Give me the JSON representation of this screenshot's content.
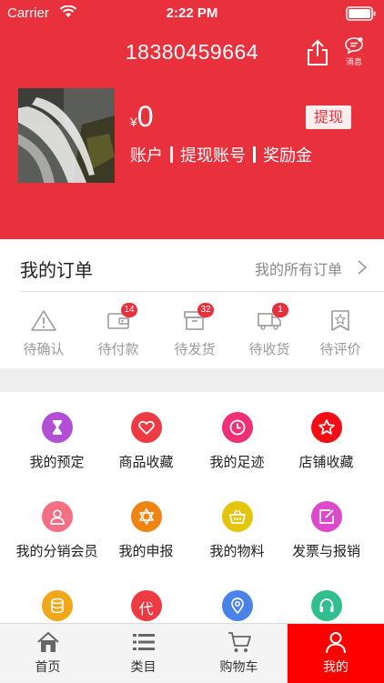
{
  "status_bar": {
    "carrier": "Carrier",
    "time": "2:22 PM"
  },
  "header": {
    "phone": "18380459664",
    "message_label": "消息",
    "currency": "¥",
    "balance": "0",
    "withdraw_label": "提现",
    "links": [
      "账户",
      "提现账号",
      "奖励金"
    ],
    "accent_color": "#e8313d"
  },
  "orders": {
    "title": "我的订单",
    "all_label": "我的所有订单",
    "statuses": [
      {
        "label": "待确认",
        "icon": "warning-icon",
        "badge": ""
      },
      {
        "label": "待付款",
        "icon": "wallet-icon",
        "badge": "14"
      },
      {
        "label": "待发货",
        "icon": "box-icon",
        "badge": "32"
      },
      {
        "label": "待收货",
        "icon": "truck-icon",
        "badge": "1"
      },
      {
        "label": "待评价",
        "icon": "review-icon",
        "badge": ""
      }
    ]
  },
  "features": [
    {
      "label": "我的预定",
      "icon": "hourglass-icon",
      "color": "#b24fd6"
    },
    {
      "label": "商品收藏",
      "icon": "heart-icon",
      "color": "#ee3b43"
    },
    {
      "label": "我的足迹",
      "icon": "clock-icon",
      "color": "#ef2f76"
    },
    {
      "label": "店铺收藏",
      "icon": "star-icon",
      "color": "#f40d15"
    },
    {
      "label": "我的分销会员",
      "icon": "user-icon",
      "color": "#f46e84"
    },
    {
      "label": "我的申报",
      "icon": "star-of-david-icon",
      "color": "#ef8413"
    },
    {
      "label": "我的物料",
      "icon": "basket-icon",
      "color": "#e5c50c"
    },
    {
      "label": "发票与报销",
      "icon": "edit-icon",
      "color": "#dc49c9"
    },
    {
      "label": "",
      "icon": "database-icon",
      "color": "#f2a619"
    },
    {
      "label": "",
      "icon": "agent-icon",
      "icon_text": "代",
      "color": "#ee3b43"
    },
    {
      "label": "",
      "icon": "location-icon",
      "color": "#4a83e8"
    },
    {
      "label": "",
      "icon": "headset-icon",
      "color": "#31bf8f"
    }
  ],
  "tabbar": {
    "tabs": [
      {
        "label": "首页",
        "icon": "home-icon"
      },
      {
        "label": "类目",
        "icon": "list-icon"
      },
      {
        "label": "购物车",
        "icon": "cart-icon"
      },
      {
        "label": "我的",
        "icon": "user-icon",
        "active": true
      }
    ]
  }
}
